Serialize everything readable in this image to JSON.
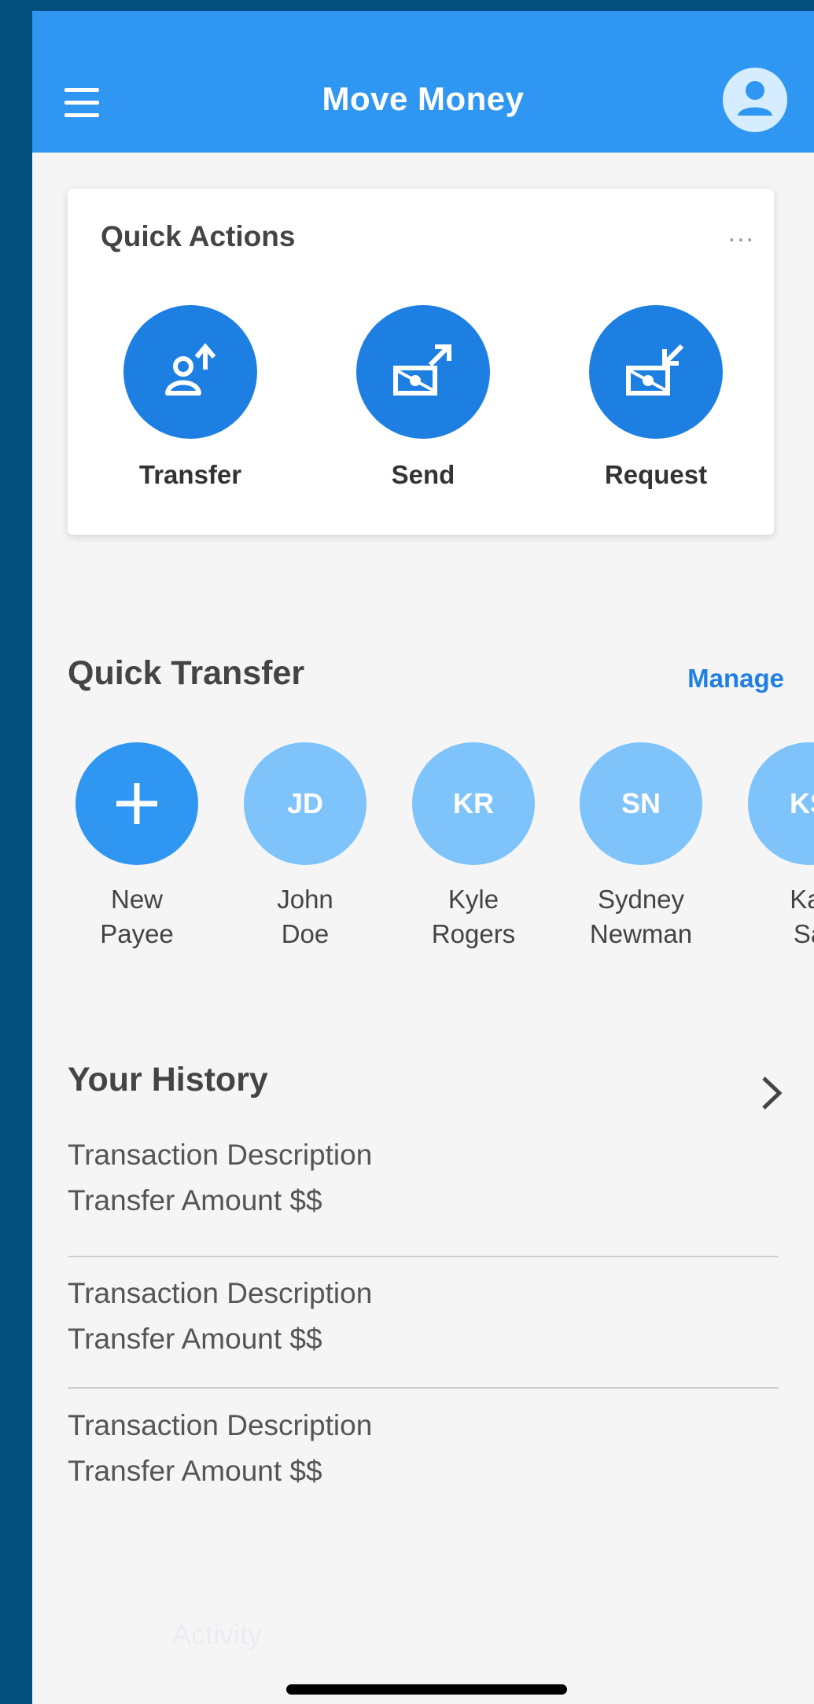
{
  "header": {
    "title": "Move Money"
  },
  "quick_actions": {
    "title": "Quick Actions",
    "more_label": "...",
    "items": [
      {
        "label": "Transfer",
        "icon": "transfer-person-icon"
      },
      {
        "label": "Send",
        "icon": "send-money-icon"
      },
      {
        "label": "Request",
        "icon": "request-money-icon"
      }
    ]
  },
  "quick_transfer": {
    "title": "Quick Transfer",
    "manage_label": "Manage",
    "payees": [
      {
        "initials": "+",
        "name_line1": "New",
        "name_line2": "Payee"
      },
      {
        "initials": "JD",
        "name_line1": "John",
        "name_line2": "Doe"
      },
      {
        "initials": "KR",
        "name_line1": "Kyle",
        "name_line2": "Rogers"
      },
      {
        "initials": "SN",
        "name_line1": "Sydney",
        "name_line2": "Newman"
      },
      {
        "initials": "KS",
        "name_line1": "Kat",
        "name_line2": "Sa"
      }
    ]
  },
  "history": {
    "title": "Your History",
    "items": [
      {
        "description": "Transaction Description",
        "amount": "Transfer Amount $$"
      },
      {
        "description": "Transaction Description",
        "amount": "Transfer Amount $$"
      },
      {
        "description": "Transaction Description",
        "amount": "Transfer Amount $$"
      }
    ]
  },
  "footer": {
    "activity_label": "Activity"
  },
  "colors": {
    "app_bar": "#2f97f2",
    "action_circle": "#1e7fe3",
    "payee_circle": "#7fc3fb",
    "link": "#1f7fe3",
    "outer_background": "#03507f"
  }
}
